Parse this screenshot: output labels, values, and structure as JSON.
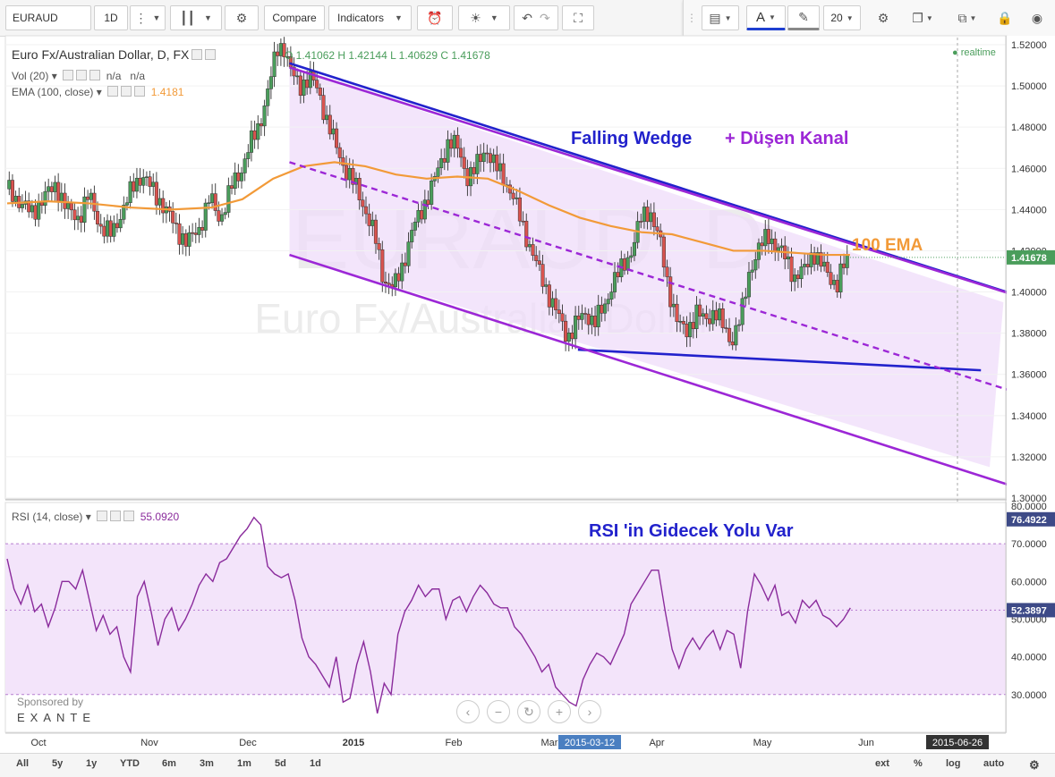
{
  "toolbar": {
    "symbol": "EURAUD",
    "interval": "1D",
    "compare_label": "Compare",
    "indicators_label": "Indicators",
    "font_size_value": "20"
  },
  "legend": {
    "title": "Euro Fx/Australian Dollar, D, FX",
    "ohlc": "O 1.41062 H 1.42144 L 1.40629 C 1.41678",
    "vol_label": "Vol (20)",
    "vol_values": "n/a   n/a",
    "ema_label": "EMA (100, close)",
    "ema_value": "1.4181",
    "rsi_label": "RSI (14, close)",
    "rsi_value": "55.0920",
    "realtime": "realtime"
  },
  "watermark": {
    "symbol": "EURAUD, D",
    "name": "Euro Fx/Australian Dollar"
  },
  "sponsor": {
    "line1": "Sponsored by",
    "line2": "EXANTE"
  },
  "colors": {
    "up": "#4a9d5b",
    "down": "#d9534f",
    "ema": "#f29a38",
    "wedge": "#2222cc",
    "channel": "#9c27d6",
    "rsi": "#8a2b9c"
  },
  "chart_data": [
    {
      "type": "candlestick",
      "title": "Euro Fx/Australian Dollar, D, FX",
      "annotations": [
        "Falling Wedge",
        "+ Düşen Kanal",
        "100 EMA"
      ],
      "y_ticks": [
        "1.52000",
        "1.50000",
        "1.48000",
        "1.46000",
        "1.44000",
        "1.42000",
        "1.40000",
        "1.38000",
        "1.36000",
        "1.34000",
        "1.32000",
        "1.30000"
      ],
      "ylim": [
        1.3,
        1.52
      ],
      "last_price": "1.41678",
      "x_ticks": [
        "Oct",
        "Nov",
        "Dec",
        "2015",
        "Feb",
        "Mar",
        "2015-03-12",
        "Apr",
        "May",
        "Jun",
        "2015-06-26"
      ],
      "close_path": [
        [
          0,
          1.45
        ],
        [
          6,
          1.444
        ],
        [
          12,
          1.438
        ],
        [
          18,
          1.446
        ],
        [
          24,
          1.452
        ],
        [
          29,
          1.44
        ],
        [
          35,
          1.436
        ],
        [
          40,
          1.447
        ],
        [
          46,
          1.431
        ],
        [
          51,
          1.428
        ],
        [
          57,
          1.441
        ],
        [
          62,
          1.452
        ],
        [
          66,
          1.457
        ],
        [
          72,
          1.448
        ],
        [
          77,
          1.441
        ],
        [
          83,
          1.43
        ],
        [
          88,
          1.424
        ],
        [
          94,
          1.431
        ],
        [
          99,
          1.446
        ],
        [
          104,
          1.435
        ],
        [
          110,
          1.452
        ],
        [
          114,
          1.458
        ],
        [
          118,
          1.47
        ],
        [
          123,
          1.48
        ],
        [
          128,
          1.5
        ],
        [
          132,
          1.518
        ],
        [
          135,
          1.52
        ],
        [
          139,
          1.506
        ],
        [
          143,
          1.5
        ],
        [
          148,
          1.504
        ],
        [
          152,
          1.498
        ],
        [
          156,
          1.484
        ],
        [
          161,
          1.47
        ],
        [
          165,
          1.46
        ],
        [
          170,
          1.452
        ],
        [
          175,
          1.44
        ],
        [
          180,
          1.426
        ],
        [
          184,
          1.406
        ],
        [
          189,
          1.402
        ],
        [
          193,
          1.412
        ],
        [
          198,
          1.43
        ],
        [
          202,
          1.438
        ],
        [
          207,
          1.45
        ],
        [
          211,
          1.46
        ],
        [
          216,
          1.474
        ],
        [
          220,
          1.47
        ],
        [
          225,
          1.456
        ],
        [
          229,
          1.46
        ],
        [
          234,
          1.47
        ],
        [
          238,
          1.462
        ],
        [
          243,
          1.455
        ],
        [
          247,
          1.447
        ],
        [
          252,
          1.432
        ],
        [
          256,
          1.421
        ],
        [
          260,
          1.41
        ],
        [
          265,
          1.398
        ],
        [
          270,
          1.387
        ],
        [
          274,
          1.378
        ],
        [
          279,
          1.386
        ],
        [
          283,
          1.39
        ],
        [
          287,
          1.385
        ],
        [
          292,
          1.393
        ],
        [
          296,
          1.405
        ],
        [
          301,
          1.412
        ],
        [
          305,
          1.42
        ],
        [
          310,
          1.436
        ],
        [
          314,
          1.44
        ],
        [
          319,
          1.425
        ],
        [
          323,
          1.403
        ],
        [
          328,
          1.384
        ],
        [
          332,
          1.381
        ],
        [
          337,
          1.39
        ],
        [
          341,
          1.386
        ],
        [
          346,
          1.391
        ],
        [
          350,
          1.383
        ],
        [
          354,
          1.376
        ],
        [
          359,
          1.389
        ],
        [
          363,
          1.411
        ],
        [
          367,
          1.42
        ],
        [
          372,
          1.428
        ],
        [
          376,
          1.422
        ],
        [
          381,
          1.416
        ],
        [
          385,
          1.407
        ],
        [
          390,
          1.411
        ],
        [
          394,
          1.42
        ],
        [
          398,
          1.413
        ],
        [
          403,
          1.406
        ],
        [
          406,
          1.404
        ],
        [
          408,
          1.411
        ],
        [
          412,
          1.417
        ]
      ],
      "ema_path": [
        [
          0,
          1.443
        ],
        [
          20,
          1.444
        ],
        [
          40,
          1.443
        ],
        [
          60,
          1.441
        ],
        [
          80,
          1.44
        ],
        [
          100,
          1.441
        ],
        [
          115,
          1.445
        ],
        [
          130,
          1.455
        ],
        [
          145,
          1.461
        ],
        [
          160,
          1.463
        ],
        [
          175,
          1.461
        ],
        [
          190,
          1.457
        ],
        [
          205,
          1.455
        ],
        [
          220,
          1.456
        ],
        [
          235,
          1.455
        ],
        [
          250,
          1.449
        ],
        [
          265,
          1.442
        ],
        [
          280,
          1.436
        ],
        [
          295,
          1.432
        ],
        [
          310,
          1.429
        ],
        [
          325,
          1.428
        ],
        [
          340,
          1.424
        ],
        [
          355,
          1.42
        ],
        [
          370,
          1.42
        ],
        [
          385,
          1.419
        ],
        [
          400,
          1.418
        ],
        [
          412,
          1.418
        ]
      ],
      "trendlines": [
        {
          "name": "Falling Wedge",
          "from": [
            138,
            1.511
          ],
          "to": [
            498,
            1.397
          ]
        },
        {
          "name": "Falling Wedge",
          "from": [
            279,
            1.372
          ],
          "to": [
            476,
            1.362
          ]
        },
        {
          "name": "Düşen Kanal",
          "from": [
            138,
            1.509
          ],
          "to": [
            494,
            1.398
          ]
        },
        {
          "name": "Düşen Kanal",
          "from": [
            138,
            1.463
          ],
          "to": [
            494,
            1.351
          ]
        },
        {
          "name": "Düşen Kanal",
          "from": [
            138,
            1.418
          ],
          "to": [
            494,
            1.305
          ]
        }
      ]
    },
    {
      "type": "line",
      "title": "RSI (14, close)",
      "annotations": [
        "RSI 'in Gidecek Yolu Var"
      ],
      "y_ticks": [
        "80.0000",
        "70.0000",
        "60.0000",
        "50.0000",
        "40.0000",
        "30.0000"
      ],
      "ylim": [
        24,
        81
      ],
      "band": [
        30,
        70
      ],
      "labels": [
        "76.4922",
        "52.3897"
      ],
      "series": [
        {
          "name": "",
          "values": [
            [
              0,
              66
            ],
            [
              3,
              58
            ],
            [
              6,
              54
            ],
            [
              9,
              59
            ],
            [
              12,
              52
            ],
            [
              15,
              54
            ],
            [
              18,
              48
            ],
            [
              21,
              53
            ],
            [
              24,
              60
            ],
            [
              27,
              60
            ],
            [
              30,
              58
            ],
            [
              33,
              63
            ],
            [
              36,
              55
            ],
            [
              39,
              47
            ],
            [
              42,
              51
            ],
            [
              45,
              46
            ],
            [
              48,
              48
            ],
            [
              51,
              40
            ],
            [
              54,
              36
            ],
            [
              57,
              56
            ],
            [
              60,
              60
            ],
            [
              63,
              52
            ],
            [
              66,
              43
            ],
            [
              69,
              50
            ],
            [
              72,
              53
            ],
            [
              75,
              47
            ],
            [
              78,
              50
            ],
            [
              81,
              54
            ],
            [
              84,
              59
            ],
            [
              87,
              62
            ],
            [
              90,
              60
            ],
            [
              93,
              65
            ],
            [
              96,
              66
            ],
            [
              99,
              69
            ],
            [
              102,
              72
            ],
            [
              105,
              74
            ],
            [
              108,
              77
            ],
            [
              111,
              75
            ],
            [
              114,
              64
            ],
            [
              117,
              62
            ],
            [
              120,
              61
            ],
            [
              123,
              62
            ],
            [
              126,
              55
            ],
            [
              129,
              45
            ],
            [
              132,
              40
            ],
            [
              135,
              38
            ],
            [
              138,
              35
            ],
            [
              141,
              32
            ],
            [
              144,
              40
            ],
            [
              147,
              28
            ],
            [
              150,
              29
            ],
            [
              153,
              38
            ],
            [
              156,
              44
            ],
            [
              159,
              36
            ],
            [
              162,
              25
            ],
            [
              165,
              33
            ],
            [
              168,
              30
            ],
            [
              171,
              46
            ],
            [
              174,
              52
            ],
            [
              177,
              55
            ],
            [
              180,
              59
            ],
            [
              183,
              56
            ],
            [
              186,
              58
            ],
            [
              189,
              58
            ],
            [
              192,
              50
            ],
            [
              195,
              55
            ],
            [
              198,
              56
            ],
            [
              201,
              52
            ],
            [
              204,
              56
            ],
            [
              207,
              59
            ],
            [
              210,
              57
            ],
            [
              213,
              54
            ],
            [
              216,
              53
            ],
            [
              219,
              53
            ],
            [
              222,
              48
            ],
            [
              225,
              46
            ],
            [
              228,
              43
            ],
            [
              231,
              40
            ],
            [
              234,
              36
            ],
            [
              237,
              38
            ],
            [
              240,
              32
            ],
            [
              243,
              30
            ],
            [
              246,
              28
            ],
            [
              249,
              27
            ],
            [
              252,
              34
            ],
            [
              255,
              38
            ],
            [
              258,
              41
            ],
            [
              261,
              40
            ],
            [
              264,
              38
            ],
            [
              267,
              42
            ],
            [
              270,
              46
            ],
            [
              273,
              54
            ],
            [
              276,
              57
            ],
            [
              279,
              60
            ],
            [
              282,
              63
            ],
            [
              285,
              63
            ],
            [
              288,
              52
            ],
            [
              291,
              42
            ],
            [
              294,
              37
            ],
            [
              297,
              42
            ],
            [
              300,
              45
            ],
            [
              303,
              42
            ],
            [
              306,
              45
            ],
            [
              309,
              47
            ],
            [
              312,
              42
            ],
            [
              315,
              47
            ],
            [
              318,
              46
            ],
            [
              321,
              37
            ],
            [
              324,
              52
            ],
            [
              327,
              62
            ],
            [
              330,
              59
            ],
            [
              333,
              55
            ],
            [
              336,
              59
            ],
            [
              339,
              51
            ],
            [
              342,
              52
            ],
            [
              345,
              49
            ],
            [
              348,
              55
            ],
            [
              351,
              53
            ],
            [
              354,
              55
            ],
            [
              357,
              51
            ],
            [
              360,
              50
            ],
            [
              363,
              48
            ],
            [
              366,
              50
            ],
            [
              369,
              53
            ]
          ]
        }
      ]
    }
  ],
  "bottom": {
    "ranges": [
      "All",
      "5y",
      "1y",
      "YTD",
      "6m",
      "3m",
      "1m",
      "5d",
      "1d"
    ],
    "right": [
      "ext",
      "%",
      "log",
      "auto"
    ]
  }
}
